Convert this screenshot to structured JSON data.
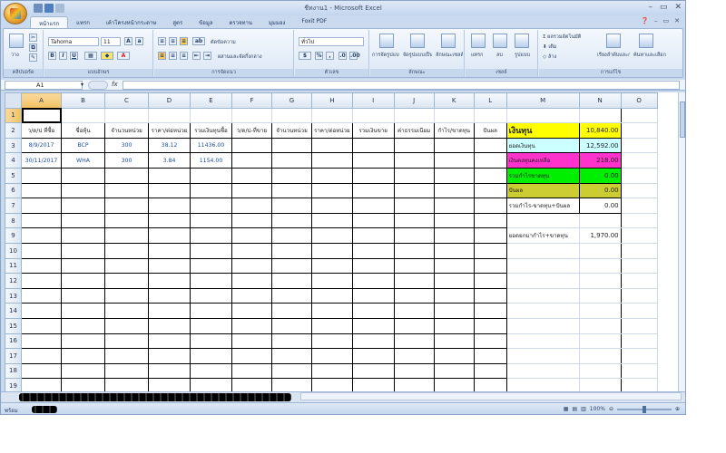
{
  "window": {
    "title": "ชีทงาน1 - Microsoft Excel"
  },
  "tabs": [
    "หน้าแรก",
    "แทรก",
    "เค้าโครงหน้ากระดาษ",
    "สูตร",
    "ข้อมูล",
    "ตรวจทาน",
    "มุมมอง",
    "Foxit PDF"
  ],
  "ribbon": {
    "clipboard": {
      "paste_label": "วาง",
      "group_label": "คลิปบอร์ด"
    },
    "font": {
      "font_name": "Tahoma",
      "font_size": "11",
      "bold": "B",
      "italic": "I",
      "underline": "U",
      "group_label": "แบบอักษร"
    },
    "alignment": {
      "wrap_label": "ตัดข้อความ",
      "merge_label": "ผสานและจัดกึ่งกลาง",
      "group_label": "การจัดแนว"
    },
    "number": {
      "format_value": "ทั่วไป",
      "group_label": "ตัวเลข"
    },
    "styles": {
      "cond_label": "การจัดรูปแบบตามเงื่อนไข",
      "table_label": "จัดรูปแบบเป็นตาราง",
      "cell_label": "ลักษณะเซลล์",
      "group_label": "ลักษณะ"
    },
    "cells": {
      "insert_label": "แทรก",
      "delete_label": "ลบ",
      "format_label": "รูปแบบ",
      "group_label": "เซลล์"
    },
    "editing": {
      "autosum_label": "ผลรวมอัตโนมัติ",
      "fill_label": "เติม",
      "clear_label": "ล้าง",
      "sort_label": "เรียงลำดับและกรอง",
      "find_label": "ค้นหาและเลือก",
      "group_label": "การแก้ไข"
    }
  },
  "formula_bar": {
    "name_box": "A1",
    "fx": "fx",
    "value": ""
  },
  "sheet": {
    "columns": [
      "A",
      "B",
      "C",
      "D",
      "E",
      "F",
      "G",
      "H",
      "I",
      "J",
      "K",
      "L",
      "M",
      "N",
      "O"
    ],
    "selected_col": "A",
    "selected_row": 1,
    "rows": [
      1,
      2,
      3,
      4,
      5,
      6,
      7,
      8,
      9,
      10,
      11,
      12,
      13,
      14,
      15,
      16,
      17,
      18,
      19
    ],
    "headers": [
      "ว/ด/ป ที่ซื้อ",
      "ชื่อหุ้น",
      "จำนวนหน่วย",
      "ราคา/ต่อหน่วย",
      "รวมเงินทุนซื้อ",
      "ว/ด/ป-ที่ขาย",
      "จำนวนหน่วย",
      "ราคา/ต่อหน่วย",
      "รวมเงินขาย",
      "ค่าธรรมเนียม",
      "กำไร/ขาดทุน",
      "ปันผล"
    ],
    "data_rows": [
      [
        "8/9/2017",
        "BCP",
        "300",
        "38.12",
        "11436.00"
      ],
      [
        "30/11/2017",
        "WHA",
        "300",
        "3.84",
        "1154.00"
      ]
    ],
    "summary": {
      "title": "เงินทุน",
      "title_value": "10,840.00",
      "items": [
        {
          "label": "ยอดเงินทุน",
          "value": "12,592.00",
          "color": "#ccffff"
        },
        {
          "label": "เงินคงทุนคงเหลือ",
          "value": "218.00",
          "color": "#ff33cc"
        },
        {
          "label": "รวมกำไรขาดทุน",
          "value": "0.00",
          "color": "#00ee00"
        },
        {
          "label": "ปันผล",
          "value": "0.00",
          "color": "#cccc33"
        },
        {
          "label": "รวมกำไร-ขาดทุน+ปันผล",
          "value": "0.00",
          "color": "#ffffff"
        }
      ],
      "total_label": "ยอดยกมากำไร+ขาดทุน",
      "total_value": "1,970.00",
      "title_color": "#ffff00"
    }
  },
  "status": {
    "ready": "พร้อม",
    "zoom": "100%"
  }
}
